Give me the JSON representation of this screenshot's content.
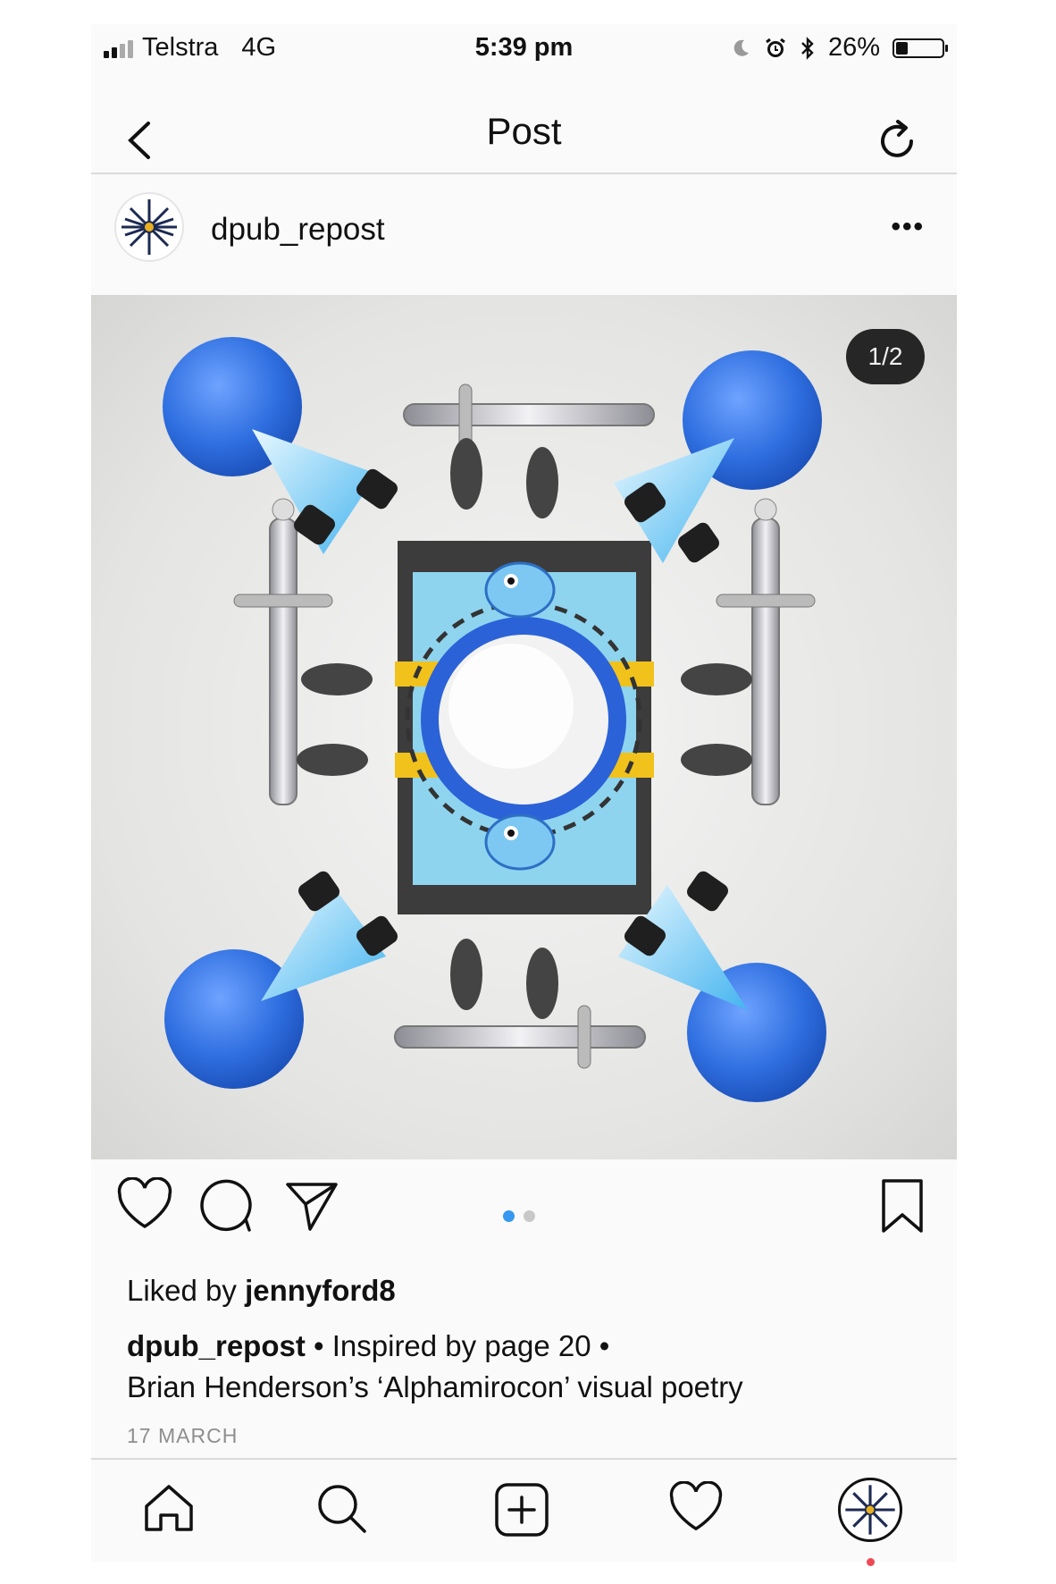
{
  "status_bar": {
    "carrier": "Telstra",
    "network": "4G",
    "time": "5:39 pm",
    "battery": "26%",
    "battery_level": 0.26
  },
  "nav": {
    "title": "Post",
    "back_icon": "chevron-left-icon",
    "refresh_icon": "refresh-icon"
  },
  "post": {
    "username": "dpub_repost",
    "more_icon": "more-horizontal-icon",
    "image_counter": "1/2",
    "carousel_index": 0,
    "carousel_count": 2,
    "liked_by_prefix": "Liked by",
    "liked_by_user": "jennyford8",
    "caption_user": "dpub_repost",
    "caption_line1": " • Inspired by page 20 •",
    "caption_line2": "Brian Henderson’s ‘Alphamirocon’ visual poetry",
    "date": "17 MARCH"
  },
  "colors": {
    "accent_blue": "#3897f0",
    "badge_bg": "#262626",
    "notification_dot": "#ed4956",
    "orb_blue": "#2f6fe0"
  },
  "tab_bar": {
    "items": [
      "home-icon",
      "search-icon",
      "new-post-icon",
      "activity-heart-icon",
      "profile-avatar"
    ]
  }
}
